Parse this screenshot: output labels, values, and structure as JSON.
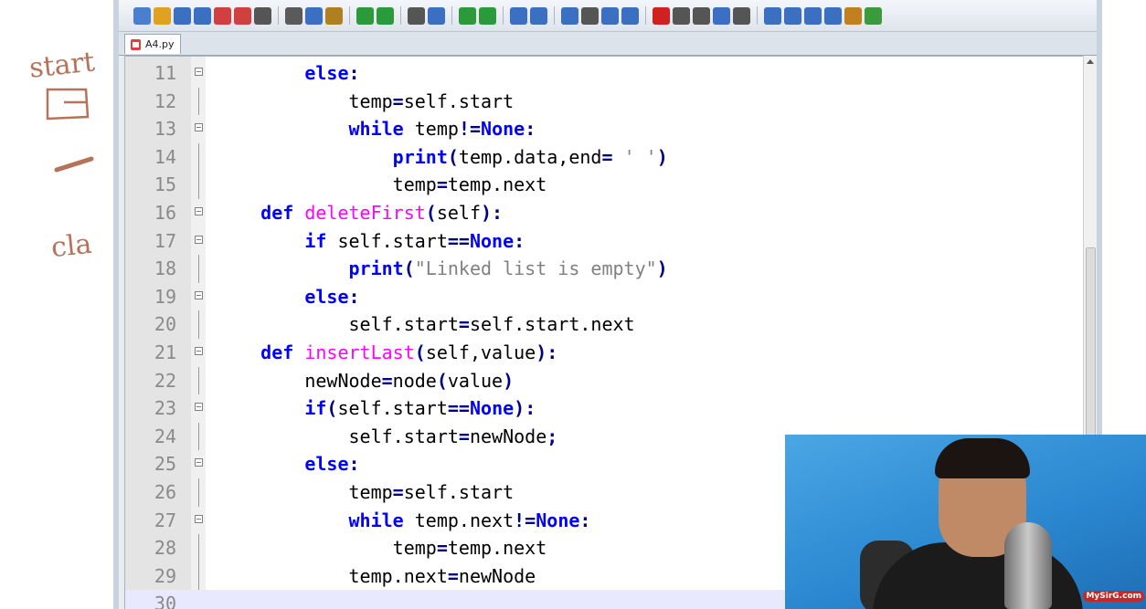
{
  "whiteboard": {
    "notes": [
      "start",
      "cla"
    ]
  },
  "editor": {
    "tab_label": "A4.py",
    "toolbar_icons": [
      "new-file-icon",
      "open-icon",
      "save-icon",
      "save-all-icon",
      "close-icon",
      "close-all-icon",
      "print-icon",
      "cut-icon",
      "copy-icon",
      "paste-icon",
      "undo-icon",
      "redo-icon",
      "find-icon",
      "replace-icon",
      "zoom-in-icon",
      "zoom-out-icon",
      "sync-v-icon",
      "sync-h-icon",
      "wrap-icon",
      "show-all-chars-icon",
      "indent-guide-icon",
      "doc-map-icon",
      "record-macro-icon",
      "stop-macro-icon",
      "play-macro-icon",
      "run-macro-icon",
      "save-macro-icon",
      "function-list-icon",
      "up-icon",
      "down-icon",
      "panel-icon",
      "folder-icon",
      "spellcheck-icon"
    ],
    "lines": [
      {
        "num": "11",
        "fold": "box",
        "tokens": [
          [
            "        ",
            ""
          ],
          [
            "else",
            "kw"
          ],
          [
            ":",
            "op"
          ]
        ]
      },
      {
        "num": "12",
        "fold": "line",
        "tokens": [
          [
            "            temp",
            ""
          ],
          [
            "=",
            "op"
          ],
          [
            "self.start",
            ""
          ]
        ]
      },
      {
        "num": "13",
        "fold": "box",
        "tokens": [
          [
            "            ",
            ""
          ],
          [
            "while",
            "kw"
          ],
          [
            " temp",
            ""
          ],
          [
            "!=",
            "op"
          ],
          [
            "None",
            "kw"
          ],
          [
            ":",
            "op"
          ]
        ]
      },
      {
        "num": "14",
        "fold": "line",
        "tokens": [
          [
            "                ",
            ""
          ],
          [
            "print",
            "kw"
          ],
          [
            "(",
            "op"
          ],
          [
            "temp.data,end",
            ""
          ],
          [
            "=",
            "op"
          ],
          [
            " ",
            ""
          ],
          [
            "' '",
            "str"
          ],
          [
            ")",
            "op"
          ]
        ]
      },
      {
        "num": "15",
        "fold": "line",
        "tokens": [
          [
            "                temp",
            ""
          ],
          [
            "=",
            "op"
          ],
          [
            "temp.next",
            ""
          ]
        ]
      },
      {
        "num": "16",
        "fold": "box",
        "tokens": [
          [
            "    ",
            ""
          ],
          [
            "def",
            "kw"
          ],
          [
            " ",
            ""
          ],
          [
            "deleteFirst",
            "fn"
          ],
          [
            "(",
            "op"
          ],
          [
            "self",
            ""
          ],
          [
            "):",
            "op"
          ]
        ]
      },
      {
        "num": "17",
        "fold": "box",
        "tokens": [
          [
            "        ",
            ""
          ],
          [
            "if",
            "kw"
          ],
          [
            " self.start",
            ""
          ],
          [
            "==",
            "op"
          ],
          [
            "None",
            "kw"
          ],
          [
            ":",
            "op"
          ]
        ]
      },
      {
        "num": "18",
        "fold": "line",
        "tokens": [
          [
            "            ",
            ""
          ],
          [
            "print",
            "kw"
          ],
          [
            "(",
            "op"
          ],
          [
            "\"Linked list is empty\"",
            "str"
          ],
          [
            ")",
            "op"
          ]
        ]
      },
      {
        "num": "19",
        "fold": "box",
        "tokens": [
          [
            "        ",
            ""
          ],
          [
            "else",
            "kw"
          ],
          [
            ":",
            "op"
          ]
        ]
      },
      {
        "num": "20",
        "fold": "line",
        "tokens": [
          [
            "            self.start",
            ""
          ],
          [
            "=",
            "op"
          ],
          [
            "self.start.next",
            ""
          ]
        ]
      },
      {
        "num": "21",
        "fold": "box",
        "tokens": [
          [
            "    ",
            ""
          ],
          [
            "def",
            "kw"
          ],
          [
            " ",
            ""
          ],
          [
            "insertLast",
            "fn"
          ],
          [
            "(",
            "op"
          ],
          [
            "self,value",
            ""
          ],
          [
            "):",
            "op"
          ]
        ]
      },
      {
        "num": "22",
        "fold": "line",
        "tokens": [
          [
            "        newNode",
            ""
          ],
          [
            "=",
            "op"
          ],
          [
            "node",
            ""
          ],
          [
            "(",
            "op"
          ],
          [
            "value",
            ""
          ],
          [
            ")",
            "op"
          ]
        ]
      },
      {
        "num": "23",
        "fold": "box",
        "tokens": [
          [
            "        ",
            ""
          ],
          [
            "if",
            "kw"
          ],
          [
            "(",
            "op"
          ],
          [
            "self.start",
            ""
          ],
          [
            "==",
            "op"
          ],
          [
            "None",
            "kw"
          ],
          [
            "):",
            "op"
          ]
        ]
      },
      {
        "num": "24",
        "fold": "line",
        "tokens": [
          [
            "            self.start",
            ""
          ],
          [
            "=",
            "op"
          ],
          [
            "newNode",
            ""
          ],
          [
            ";",
            "op"
          ]
        ]
      },
      {
        "num": "25",
        "fold": "box",
        "tokens": [
          [
            "        ",
            ""
          ],
          [
            "else",
            "kw"
          ],
          [
            ":",
            "op"
          ]
        ]
      },
      {
        "num": "26",
        "fold": "line",
        "tokens": [
          [
            "            temp",
            ""
          ],
          [
            "=",
            "op"
          ],
          [
            "self.start",
            ""
          ]
        ]
      },
      {
        "num": "27",
        "fold": "box",
        "tokens": [
          [
            "            ",
            ""
          ],
          [
            "while",
            "kw"
          ],
          [
            " temp.next",
            ""
          ],
          [
            "!=",
            "op"
          ],
          [
            "None",
            "kw"
          ],
          [
            ":",
            "op"
          ]
        ]
      },
      {
        "num": "28",
        "fold": "line",
        "tokens": [
          [
            "                temp",
            ""
          ],
          [
            "=",
            "op"
          ],
          [
            "temp.next",
            ""
          ]
        ]
      },
      {
        "num": "29",
        "fold": "line",
        "tokens": [
          [
            "            temp.next",
            ""
          ],
          [
            "=",
            "op"
          ],
          [
            "newNode",
            ""
          ]
        ]
      },
      {
        "num": "30",
        "fold": "none",
        "tokens": [
          [
            "",
            ""
          ]
        ],
        "current": true
      }
    ]
  },
  "webcam": {
    "watermark": "MySirG.com"
  },
  "colors": {
    "keyword": "#0000ff",
    "function_name": "#ff00ff",
    "string": "#808080",
    "line_number": "#8a8a8a"
  }
}
